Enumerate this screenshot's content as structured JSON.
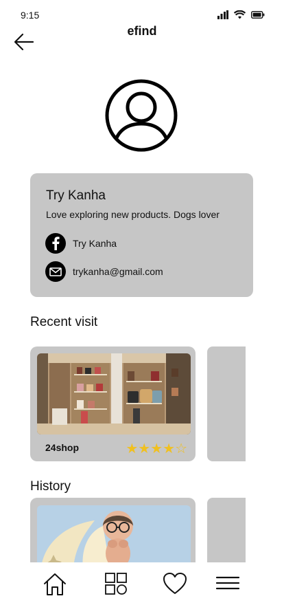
{
  "status_bar": {
    "time": "9:15"
  },
  "header": {
    "title": "efind"
  },
  "profile": {
    "name": "Try Kanha",
    "bio": "Love exploring new products. Dogs lover",
    "facebook": "Try Kanha",
    "email": "trykanha@gmail.com"
  },
  "recent": {
    "title": "Recent visit",
    "items": [
      {
        "name": "24shop",
        "rating": 4,
        "max_rating": 5
      }
    ]
  },
  "history": {
    "title": "History"
  },
  "nav": {
    "items": [
      "home-icon",
      "grid-icon",
      "heart-icon",
      "menu-icon"
    ]
  },
  "colors": {
    "card": "#c6c6c6",
    "star": "#f0c020"
  }
}
